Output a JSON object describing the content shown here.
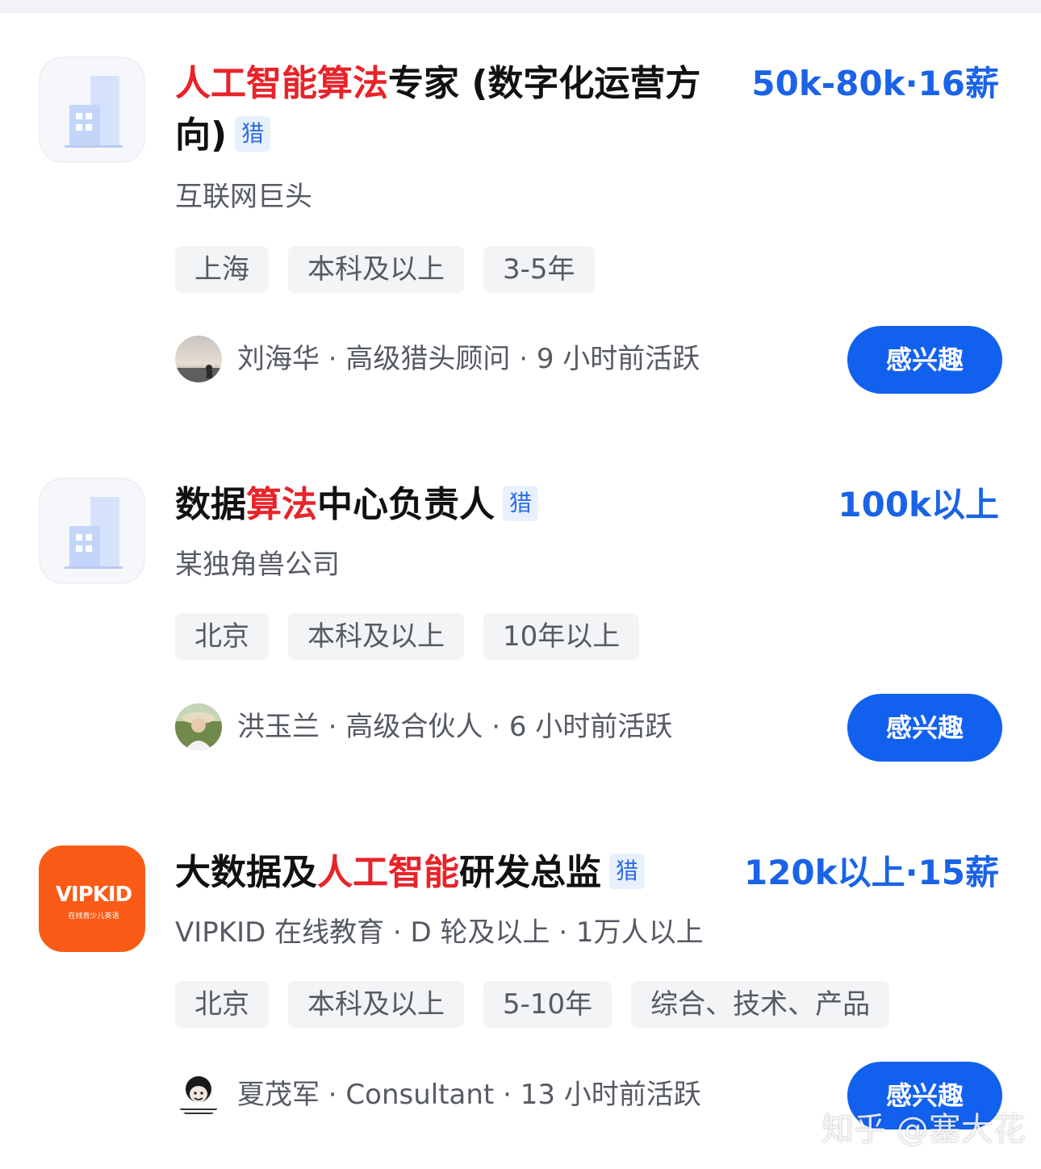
{
  "jobs": [
    {
      "title_parts": [
        {
          "text": "人工智能算法",
          "highlight": true
        },
        {
          "text": "专家 (数字化运营方向)",
          "highlight": false
        }
      ],
      "badge": "猎",
      "salary": "50k-80k·16薪",
      "company": "互联网巨头",
      "tags": [
        "上海",
        "本科及以上",
        "3-5年"
      ],
      "recruiter": "刘海华 · 高级猎头顾问 · 9 小时前活跃",
      "avatar_icon": "landscape-avatar-icon",
      "button": "感兴趣",
      "logo_icon": "building-icon"
    },
    {
      "title_parts": [
        {
          "text": "数据",
          "highlight": false
        },
        {
          "text": "算法",
          "highlight": true
        },
        {
          "text": "中心负责人",
          "highlight": false
        }
      ],
      "badge": "猎",
      "salary": "100k以上",
      "company": "某独角兽公司",
      "tags": [
        "北京",
        "本科及以上",
        "10年以上"
      ],
      "recruiter": "洪玉兰 · 高级合伙人 · 6 小时前活跃",
      "avatar_icon": "person-avatar-icon",
      "button": "感兴趣",
      "logo_icon": "building-icon"
    },
    {
      "title_parts": [
        {
          "text": "大数据及",
          "highlight": false
        },
        {
          "text": "人工智能",
          "highlight": true
        },
        {
          "text": "研发总监",
          "highlight": false
        }
      ],
      "badge": "猎",
      "salary": "120k以上·15薪",
      "company": "VIPKID 在线教育 · D 轮及以上 · 1万人以上",
      "tags": [
        "北京",
        "本科及以上",
        "5-10年",
        "综合、技术、产品"
      ],
      "recruiter": "夏茂军 · Consultant · 13 小时前活跃",
      "avatar_icon": "meme-avatar-icon",
      "button": "感兴趣",
      "logo_icon": "vipkid-logo",
      "logo_text": "VIPKID",
      "logo_subtext": "在线青少儿英语"
    }
  ],
  "watermark": "知乎 @塞大花",
  "colors": {
    "accent": "#1261ee",
    "salary": "#1a63e6",
    "highlight": "#e8232a",
    "vipkid": "#fa5b17"
  }
}
